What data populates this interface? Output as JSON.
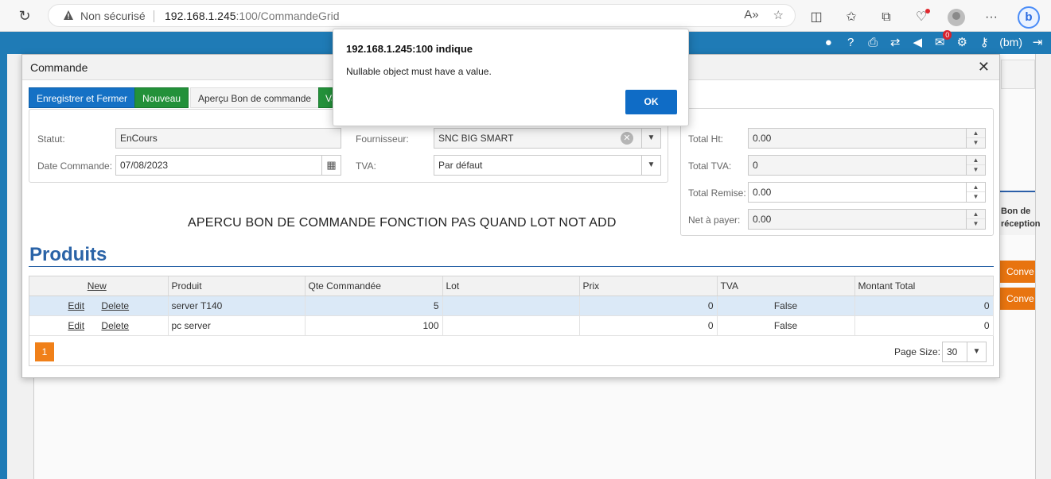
{
  "browser": {
    "insecure_label": "Non sécurisé",
    "url_host": "192.168.1.245",
    "url_rest": ":100/CommandeGrid"
  },
  "app": {
    "user_label": "(bm)",
    "badge_count": "0"
  },
  "background": {
    "column_header": "Bon de réception",
    "button_label": "Conve"
  },
  "modal": {
    "title": "Commande",
    "close_glyph": "✕",
    "buttons": {
      "save_close": "Enregistrer et Fermer",
      "new": "Nouveau",
      "preview": "Aperçu Bon de commande",
      "validate": "Va"
    },
    "fields": {
      "statut_label": "Statut:",
      "statut_value": "EnCours",
      "date_label": "Date Commande:",
      "date_value": "07/08/2023",
      "fournisseur_label": "Fournisseur:",
      "fournisseur_value": "SNC BIG SMART",
      "tva_label": "TVA:",
      "tva_value": "Par défaut"
    },
    "totals": {
      "total_ht_label": "Total Ht:",
      "total_ht_value": "0.00",
      "total_tva_label": "Total TVA:",
      "total_tva_value": "0",
      "total_remise_label": "Total Remise:",
      "total_remise_value": "0.00",
      "net_label": "Net à payer:",
      "net_value": "0.00"
    },
    "note": "APERCU BON DE COMMANDE FONCTION PAS QUAND LOT NOT ADD",
    "section_title": "Produits",
    "grid": {
      "new_link": "New",
      "columns": [
        "Produit",
        "Qte Commandée",
        "Lot",
        "Prix",
        "TVA",
        "Montant Total"
      ],
      "edit_label": "Edit",
      "delete_label": "Delete",
      "rows": [
        {
          "produit": "server T140",
          "qte": "5",
          "lot": "",
          "prix": "0",
          "tva": "False",
          "montant": "0"
        },
        {
          "produit": "pc server",
          "qte": "100",
          "lot": "",
          "prix": "0",
          "tva": "False",
          "montant": "0"
        }
      ],
      "page": "1",
      "page_size_label": "Page Size:",
      "page_size_value": "30"
    }
  },
  "alert": {
    "title": "192.168.1.245:100 indique",
    "message": "Nullable object must have a value.",
    "ok_label": "OK"
  }
}
